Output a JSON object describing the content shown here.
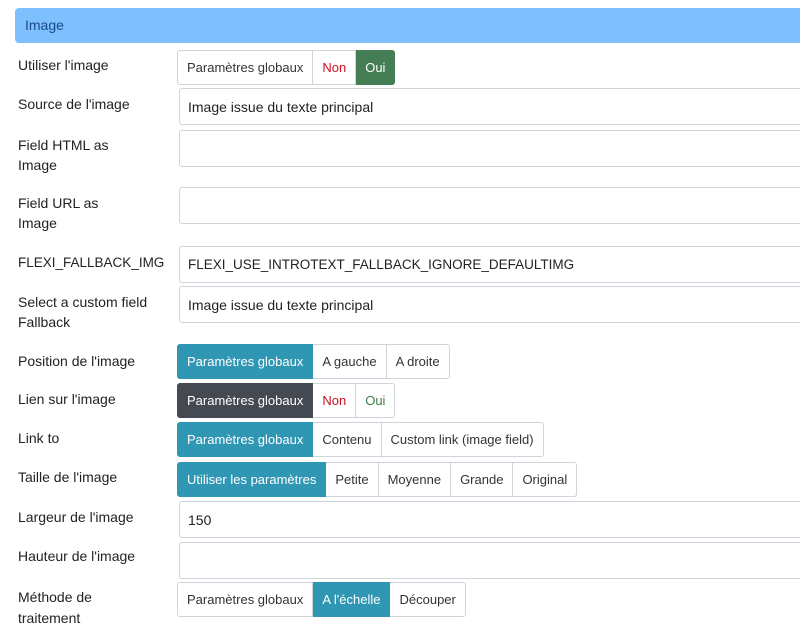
{
  "section_title": "Image",
  "rows": {
    "use_image": {
      "label": "Utiliser l'image",
      "options": [
        "Paramètres globaux",
        "Non",
        "Oui"
      ]
    },
    "image_source": {
      "label": "Source de l'image",
      "value": "Image issue du texte principal"
    },
    "field_html": {
      "label": "Field HTML as Image",
      "value": ""
    },
    "field_url": {
      "label": "Field URL as Image",
      "value": ""
    },
    "fallback": {
      "label": "FLEXI_FALLBACK_IMG",
      "value": "FLEXI_USE_INTROTEXT_FALLBACK_IGNORE_DEFAULTIMG"
    },
    "custom_fallback": {
      "label": "Select a custom field Fallback",
      "value": "Image issue du texte principal"
    },
    "position": {
      "label": "Position de l'image",
      "options": [
        "Paramètres globaux",
        "A gauche",
        "A droite"
      ]
    },
    "link_image": {
      "label": "Lien sur l'image",
      "options": [
        "Paramètres globaux",
        "Non",
        "Oui"
      ]
    },
    "link_to": {
      "label": "Link to",
      "options": [
        "Paramètres globaux",
        "Contenu",
        "Custom link (image field)"
      ]
    },
    "size": {
      "label": "Taille de l'image",
      "options": [
        "Utiliser les paramètres",
        "Petite",
        "Moyenne",
        "Grande",
        "Original"
      ]
    },
    "width": {
      "label": "Largeur de l'image",
      "value": "150"
    },
    "height": {
      "label": "Hauteur de l'image",
      "value": ""
    },
    "method": {
      "label": "Méthode de traitement",
      "options": [
        "Paramètres globaux",
        "A l'échelle",
        "Découper"
      ]
    }
  },
  "colors": {
    "header_bg": "#7ebfff",
    "active_blue": "#2f96b4",
    "active_green": "#457d54",
    "active_dark": "#454a52",
    "no_red": "#c8101e"
  }
}
